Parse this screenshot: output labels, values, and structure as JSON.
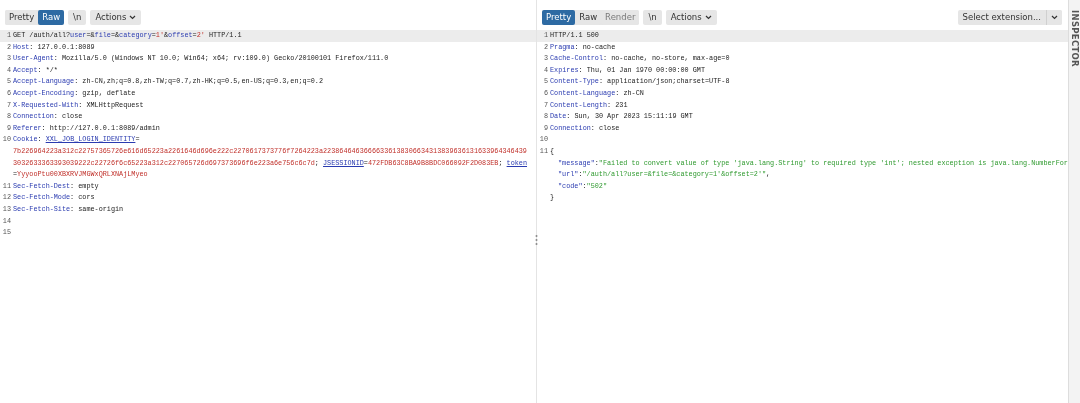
{
  "request": {
    "view_tabs": [
      {
        "label": "Pretty",
        "selected": false,
        "disabled": false
      },
      {
        "label": "Raw",
        "selected": true,
        "disabled": false
      }
    ],
    "newline_toggle": "\\n",
    "actions": "Actions",
    "lines": [
      {
        "number": "1",
        "highlighted": true,
        "rows": [
          {
            "segments": [
              {
                "kind": "plain",
                "text": "GET /auth/all?"
              },
              {
                "kind": "key",
                "text": "user"
              },
              {
                "kind": "plain",
                "text": "=&"
              },
              {
                "kind": "key",
                "text": "file"
              },
              {
                "kind": "plain",
                "text": "=&"
              },
              {
                "kind": "key",
                "text": "category"
              },
              {
                "kind": "plain",
                "text": "="
              },
              {
                "kind": "value",
                "text": "1'"
              },
              {
                "kind": "plain",
                "text": "&"
              },
              {
                "kind": "key",
                "text": "offset"
              },
              {
                "kind": "plain",
                "text": "="
              },
              {
                "kind": "value",
                "text": "2'"
              },
              {
                "kind": "plain",
                "text": " HTTP/1.1"
              }
            ]
          }
        ]
      },
      {
        "number": "2",
        "highlighted": false,
        "rows": [
          {
            "segments": [
              {
                "kind": "key",
                "text": "Host"
              },
              {
                "kind": "plain",
                "text": ": 127.0.0.1:8089"
              }
            ]
          }
        ]
      },
      {
        "number": "3",
        "highlighted": false,
        "rows": [
          {
            "segments": [
              {
                "kind": "key",
                "text": "User-Agent"
              },
              {
                "kind": "plain",
                "text": ": Mozilla/5.0 (Windows NT 10.0; Win64; x64; rv:109.0) Gecko/20100101 Firefox/111.0"
              }
            ]
          }
        ]
      },
      {
        "number": "4",
        "highlighted": false,
        "rows": [
          {
            "segments": [
              {
                "kind": "key",
                "text": "Accept"
              },
              {
                "kind": "plain",
                "text": ": */*"
              }
            ]
          }
        ]
      },
      {
        "number": "5",
        "highlighted": false,
        "rows": [
          {
            "segments": [
              {
                "kind": "key",
                "text": "Accept-Language"
              },
              {
                "kind": "plain",
                "text": ": zh-CN,zh;q=0.8,zh-TW;q=0.7,zh-HK;q=0.5,en-US;q=0.3,en;q=0.2"
              }
            ]
          }
        ]
      },
      {
        "number": "6",
        "highlighted": false,
        "rows": [
          {
            "segments": [
              {
                "kind": "key",
                "text": "Accept-Encoding"
              },
              {
                "kind": "plain",
                "text": ": gzip, deflate"
              }
            ]
          }
        ]
      },
      {
        "number": "7",
        "highlighted": false,
        "rows": [
          {
            "segments": [
              {
                "kind": "key",
                "text": "X-Requested-With"
              },
              {
                "kind": "plain",
                "text": ": XMLHttpRequest"
              }
            ]
          }
        ]
      },
      {
        "number": "8",
        "highlighted": false,
        "rows": [
          {
            "segments": [
              {
                "kind": "key",
                "text": "Connection"
              },
              {
                "kind": "plain",
                "text": ": close"
              }
            ]
          }
        ]
      },
      {
        "number": "9",
        "highlighted": false,
        "rows": [
          {
            "segments": [
              {
                "kind": "key",
                "text": "Referer"
              },
              {
                "kind": "plain",
                "text": ": http://127.0.0.1:8089/admin"
              }
            ]
          }
        ]
      },
      {
        "number": "10",
        "highlighted": false,
        "rows": [
          {
            "segments": [
              {
                "kind": "key",
                "text": "Cookie"
              },
              {
                "kind": "plain",
                "text": ": "
              },
              {
                "kind": "cookie",
                "text": "XXL_JOB_LOGIN_IDENTITY"
              },
              {
                "kind": "plain",
                "text": "="
              }
            ]
          },
          {
            "segments": [
              {
                "kind": "value",
                "text": "7b226964223a312c22757365726e616d65223a2261646d696e222c2270617373776f7264223a22386464636666336138306634313839636131633964346439"
              }
            ]
          },
          {
            "segments": [
              {
                "kind": "value",
                "text": "3032633363393039222c22726f6c65223a312c227065726d697373696f6e223a6e756c6c7d"
              },
              {
                "kind": "plain",
                "text": "; "
              },
              {
                "kind": "cookie",
                "text": "JSESSIONID"
              },
              {
                "kind": "plain",
                "text": "="
              },
              {
                "kind": "value",
                "text": "472FDB63C8BA9B8BDC066092F2D083EB"
              },
              {
                "kind": "plain",
                "text": "; "
              },
              {
                "kind": "cookie",
                "text": "token"
              }
            ]
          },
          {
            "segments": [
              {
                "kind": "plain",
                "text": "="
              },
              {
                "kind": "value",
                "text": "YyyooPtu00XBXRVJMGWxQRLXNAjLMyeo"
              }
            ]
          }
        ]
      },
      {
        "number": "11",
        "highlighted": false,
        "rows": [
          {
            "segments": [
              {
                "kind": "key",
                "text": "Sec-Fetch-Dest"
              },
              {
                "kind": "plain",
                "text": ": empty"
              }
            ]
          }
        ]
      },
      {
        "number": "12",
        "highlighted": false,
        "rows": [
          {
            "segments": [
              {
                "kind": "key",
                "text": "Sec-Fetch-Mode"
              },
              {
                "kind": "plain",
                "text": ": cors"
              }
            ]
          }
        ]
      },
      {
        "number": "13",
        "highlighted": false,
        "rows": [
          {
            "segments": [
              {
                "kind": "key",
                "text": "Sec-Fetch-Site"
              },
              {
                "kind": "plain",
                "text": ": same-origin"
              }
            ]
          }
        ]
      },
      {
        "number": "14",
        "highlighted": false
      },
      {
        "number": "15",
        "highlighted": false
      }
    ]
  },
  "response": {
    "view_tabs": [
      {
        "label": "Pretty",
        "selected": true,
        "disabled": false
      },
      {
        "label": "Raw",
        "selected": false,
        "disabled": false
      },
      {
        "label": "Render",
        "selected": false,
        "disabled": true
      }
    ],
    "newline_toggle": "\\n",
    "actions": "Actions",
    "extension_select": "Select extension...",
    "lines": [
      {
        "number": "1",
        "highlighted": true,
        "rows": [
          {
            "segments": [
              {
                "kind": "plain",
                "text": "HTTP/1.1 500"
              }
            ]
          }
        ]
      },
      {
        "number": "2",
        "highlighted": false,
        "rows": [
          {
            "segments": [
              {
                "kind": "key",
                "text": "Pragma"
              },
              {
                "kind": "plain",
                "text": ": no-cache"
              }
            ]
          }
        ]
      },
      {
        "number": "3",
        "highlighted": false,
        "rows": [
          {
            "segments": [
              {
                "kind": "key",
                "text": "Cache-Control"
              },
              {
                "kind": "plain",
                "text": ": no-cache, no-store, max-age=0"
              }
            ]
          }
        ]
      },
      {
        "number": "4",
        "highlighted": false,
        "rows": [
          {
            "segments": [
              {
                "kind": "key",
                "text": "Expires"
              },
              {
                "kind": "plain",
                "text": ": Thu, 01 Jan 1970 00:00:00 GMT"
              }
            ]
          }
        ]
      },
      {
        "number": "5",
        "highlighted": false,
        "rows": [
          {
            "segments": [
              {
                "kind": "key",
                "text": "Content-Type"
              },
              {
                "kind": "plain",
                "text": ": application/json;charset=UTF-8"
              }
            ]
          }
        ]
      },
      {
        "number": "6",
        "highlighted": false,
        "rows": [
          {
            "segments": [
              {
                "kind": "key",
                "text": "Content-Language"
              },
              {
                "kind": "plain",
                "text": ": zh-CN"
              }
            ]
          }
        ]
      },
      {
        "number": "7",
        "highlighted": false,
        "rows": [
          {
            "segments": [
              {
                "kind": "key",
                "text": "Content-Length"
              },
              {
                "kind": "plain",
                "text": ": 231"
              }
            ]
          }
        ]
      },
      {
        "number": "8",
        "highlighted": false,
        "rows": [
          {
            "segments": [
              {
                "kind": "key",
                "text": "Date"
              },
              {
                "kind": "plain",
                "text": ": Sun, 30 Apr 2023 15:11:19 GMT"
              }
            ]
          }
        ]
      },
      {
        "number": "9",
        "highlighted": false,
        "rows": [
          {
            "segments": [
              {
                "kind": "key",
                "text": "Connection"
              },
              {
                "kind": "plain",
                "text": ": close"
              }
            ]
          }
        ]
      },
      {
        "number": "10",
        "highlighted": false
      },
      {
        "number": "11",
        "highlighted": false,
        "rows": [
          {
            "segments": [
              {
                "kind": "plain",
                "text": "{"
              }
            ]
          },
          {
            "indented": true,
            "segments": [
              {
                "kind": "key",
                "text": "\"message\""
              },
              {
                "kind": "plain",
                "text": ":"
              },
              {
                "kind": "string",
                "text": "\"Failed to convert value of type 'java.lang.String' to required type 'int'; nested exception is java.lang.NumberFor"
              }
            ]
          },
          {
            "indented": true,
            "segments": [
              {
                "kind": "key",
                "text": "\"url\""
              },
              {
                "kind": "plain",
                "text": ":"
              },
              {
                "kind": "string",
                "text": "\"/auth/all?user=&file=&category=1'&offset=2'\""
              },
              {
                "kind": "plain",
                "text": ","
              }
            ]
          },
          {
            "indented": true,
            "segments": [
              {
                "kind": "key",
                "text": "\"code\""
              },
              {
                "kind": "plain",
                "text": ":"
              },
              {
                "kind": "string",
                "text": "\"502\""
              }
            ]
          },
          {
            "segments": [
              {
                "kind": "plain",
                "text": "}"
              }
            ]
          }
        ]
      }
    ]
  },
  "inspector": {
    "label": "INSPECTOR"
  }
}
